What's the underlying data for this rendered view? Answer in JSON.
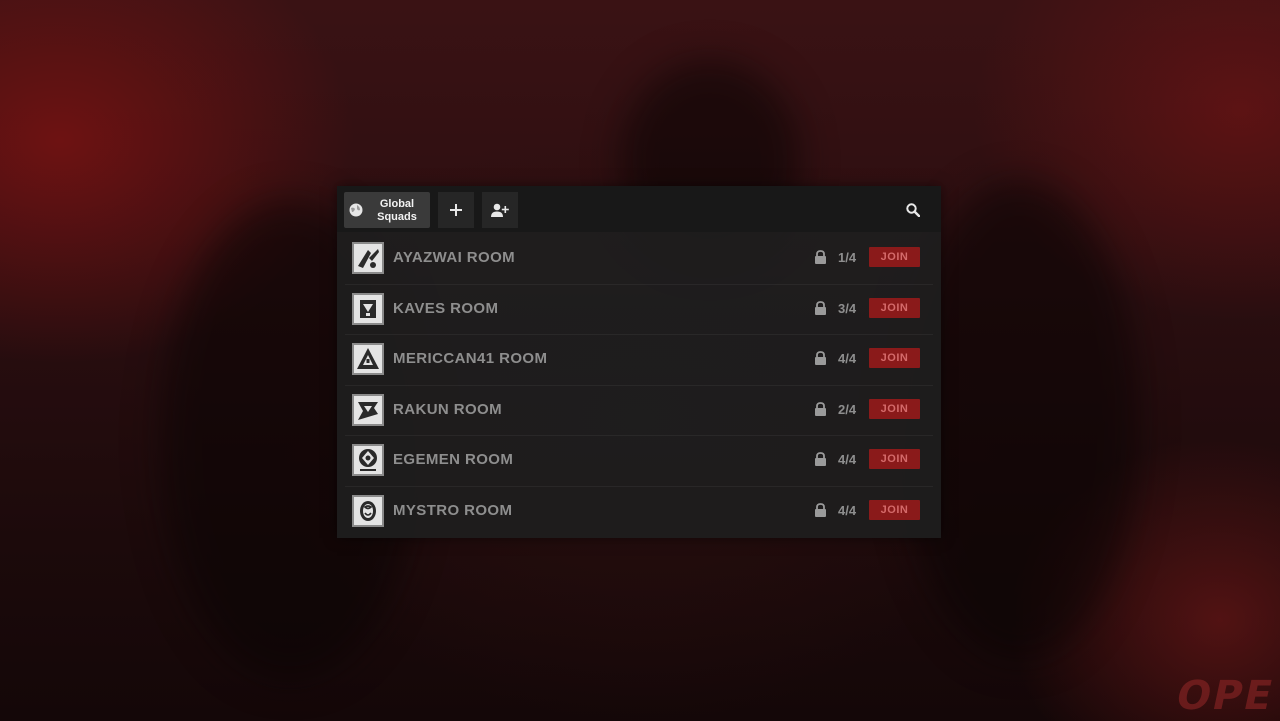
{
  "topbar": {
    "tab_global_label": "Global Squads",
    "add_icon": "plus-icon",
    "invite_icon": "add-user-icon",
    "search_icon": "search-icon"
  },
  "rooms": [
    {
      "name": "AYAZWAI ROOM",
      "count": "1/4",
      "join": "JOIN",
      "icon": "operator-badge-icon"
    },
    {
      "name": "KAVES ROOM",
      "count": "3/4",
      "join": "JOIN",
      "icon": "operator-badge-icon"
    },
    {
      "name": "MERICCAN41 ROOM",
      "count": "4/4",
      "join": "JOIN",
      "icon": "operator-badge-icon"
    },
    {
      "name": "RAKUN ROOM",
      "count": "2/4",
      "join": "JOIN",
      "icon": "operator-badge-icon"
    },
    {
      "name": "EGEMEN ROOM",
      "count": "4/4",
      "join": "JOIN",
      "icon": "operator-badge-icon"
    },
    {
      "name": "MYSTRO ROOM",
      "count": "4/4",
      "join": "JOIN",
      "icon": "operator-badge-icon"
    }
  ],
  "colors": {
    "panel": "#1e1e1e",
    "accent": "#8a1a1a",
    "join_text": "#d46a6a",
    "muted_text": "#8e8e8e"
  },
  "background": {
    "logo_text": "OPE"
  }
}
